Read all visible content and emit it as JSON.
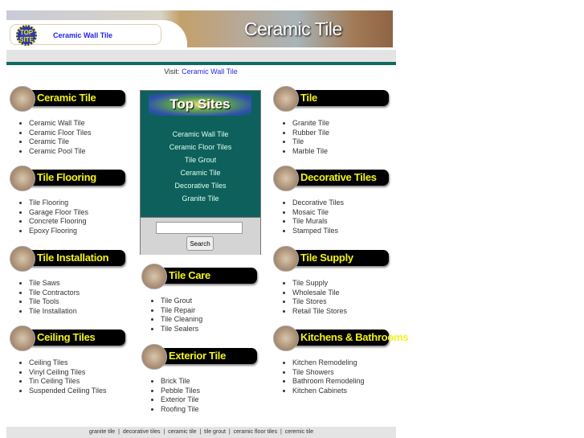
{
  "header": {
    "badge_text": "TOP SITE",
    "link": "Ceramic Wall Tile",
    "title": "Ceramic Tile"
  },
  "visit": {
    "label": "Visit:",
    "link": "Ceramic Wall Tile"
  },
  "colors": {
    "teal": "#0e6b61",
    "link": "#2a2ae0",
    "header_text": "#f2f21a"
  },
  "sections": [
    {
      "title": "Ceramic Tile",
      "items": [
        "Ceramic Wall Tile",
        "Ceramic Floor Tiles",
        "Ceramic Tile",
        "Ceramic Pool Tile"
      ]
    },
    {
      "title": "Tile Flooring",
      "items": [
        "Tile Flooring",
        "Garage Floor Tiles",
        "Concrete Flooring",
        "Epoxy Flooring"
      ]
    },
    {
      "title": "Tile Installation",
      "items": [
        "Tile Saws",
        "Tile Contractors",
        "Tile Tools",
        "Tile Installation"
      ]
    },
    {
      "title": "Ceiling Tiles",
      "items": [
        "Ceiling Tiles",
        "Vinyl Ceiling Tiles",
        "Tin Ceiling Tiles",
        "Suspended Ceiling Tiles"
      ]
    },
    {
      "title": "Tile Care",
      "items": [
        "Tile Grout",
        "Tile Repair",
        "Tile Cleaning",
        "Tile Sealers"
      ]
    },
    {
      "title": "Exterior Tile",
      "items": [
        "Brick Tile",
        "Pebble Tiles",
        "Exterior Tile",
        "Roofing Tile"
      ]
    },
    {
      "title": "Tile",
      "items": [
        "Granite Tile",
        "Rubber Tile",
        "Tile",
        "Marble Tile"
      ]
    },
    {
      "title": "Decorative Tiles",
      "items": [
        "Decorative Tiles",
        "Mosaic Tile",
        "Tile Murals",
        "Stamped Tiles"
      ]
    },
    {
      "title": "Tile Supply",
      "items": [
        "Tile Supply",
        "Wholesale Tile",
        "Tile Stores",
        "Retail Tile Stores"
      ]
    },
    {
      "title": "Kitchens & Bathrooms",
      "items": [
        "Kitchen Remodeling",
        "Tile Showers",
        "Bathroom Remodeling",
        "Kitchen Cabinets"
      ]
    }
  ],
  "top_sites": {
    "title": "Top Sites",
    "links": [
      "Ceramic Wall Tile",
      "Ceramic Floor Tiles",
      "Tile Grout",
      "Ceramic Tile",
      "Decorative Tiles",
      "Granite Tile"
    ],
    "search_value": "",
    "search_button": "Search"
  },
  "footer": {
    "links": [
      "granite tile",
      "decorative tiles",
      "ceramic tile",
      "tile grout",
      "ceramic floor tiles",
      "ceremic tile"
    ],
    "separator": "|"
  }
}
